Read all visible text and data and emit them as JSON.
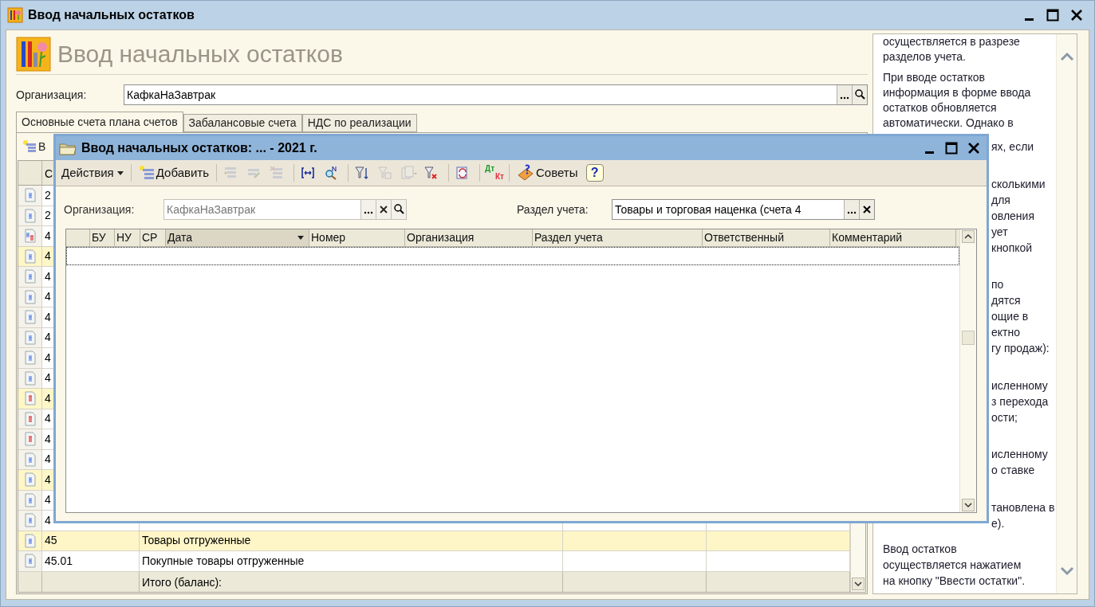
{
  "window": {
    "title": "Ввод начальных остатков"
  },
  "header": {
    "title": "Ввод начальных остатков"
  },
  "organization": {
    "label": "Организация:",
    "value": "КафкаНаЗавтрак"
  },
  "tabs": [
    {
      "label": "Основные счета плана счетов",
      "selected": true
    },
    {
      "label": "Забалансовые счета",
      "selected": false
    },
    {
      "label": "НДС по реализации",
      "selected": false
    }
  ],
  "tab_toolbar": {
    "button_label": "В"
  },
  "accounts_table": {
    "column_1": "С",
    "rows": [
      {
        "code": "2",
        "kind": "active",
        "highlighted": false
      },
      {
        "code": "2",
        "kind": "active",
        "highlighted": false
      },
      {
        "code": "4",
        "kind": "active-passive",
        "highlighted": false
      },
      {
        "code": "4",
        "kind": "active",
        "highlighted": true
      },
      {
        "code": "4",
        "kind": "active",
        "highlighted": false
      },
      {
        "code": "4",
        "kind": "active",
        "highlighted": false
      },
      {
        "code": "4",
        "kind": "active",
        "highlighted": false
      },
      {
        "code": "4",
        "kind": "active",
        "highlighted": false
      },
      {
        "code": "4",
        "kind": "active",
        "highlighted": false
      },
      {
        "code": "4",
        "kind": "active",
        "highlighted": false
      },
      {
        "code": "4",
        "kind": "passive",
        "highlighted": true
      },
      {
        "code": "4",
        "kind": "passive",
        "highlighted": false
      },
      {
        "code": "4",
        "kind": "passive",
        "highlighted": false
      },
      {
        "code": "4",
        "kind": "active",
        "highlighted": false
      },
      {
        "code": "4",
        "kind": "active",
        "highlighted": true
      },
      {
        "code": "4",
        "kind": "active",
        "highlighted": false
      },
      {
        "code": "4",
        "kind": "active",
        "highlighted": false
      },
      {
        "code": "45",
        "name": "Товары отгруженные",
        "kind": "active",
        "highlighted": true
      },
      {
        "code": "45.01",
        "name": "Покупные товары отгруженные",
        "kind": "active",
        "highlighted": false
      }
    ],
    "footer": {
      "name": "Итого (баланс):"
    }
  },
  "help": {
    "paragraphs": [
      {
        "kind": "full",
        "lines": [
          "осуществляется в разрезе",
          "разделов учета."
        ]
      },
      {
        "kind": "full",
        "lines": [
          "При вводе остатков",
          "информация в форме ввода",
          "остатков обновляется",
          "автоматически. Однако в"
        ]
      },
      {
        "kind": "partial",
        "lines": [
          "ях, если"
        ]
      },
      {
        "kind": "partial",
        "lines": [
          "сколькими",
          "для",
          "овления",
          "ует",
          "кнопкой"
        ]
      },
      {
        "kind": "partial",
        "lines": [
          "по",
          "дятся",
          "ощие в",
          "ектно",
          "гу продаж):"
        ]
      },
      {
        "kind": "partial",
        "lines": [
          "исленному",
          "з перехода",
          "ости;"
        ]
      },
      {
        "kind": "partial",
        "lines": [
          "исленному",
          "о ставке"
        ]
      },
      {
        "kind": "partial",
        "lines": [
          "тановлена в",
          "е)."
        ]
      },
      {
        "kind": "full",
        "lines": [
          "Ввод остатков",
          "осуществляется нажатием",
          "на кнопку \"Ввести остатки\"."
        ]
      }
    ]
  },
  "dialog": {
    "title": "Ввод начальных остатков: ... - 2021 г.",
    "toolbar": [
      {
        "kind": "menu",
        "label": "Действия"
      },
      {
        "kind": "separator"
      },
      {
        "kind": "button",
        "label": "Добавить"
      },
      {
        "kind": "separator"
      },
      {
        "kind": "icon",
        "disabled": true
      },
      {
        "kind": "icon",
        "disabled": true
      },
      {
        "kind": "icon",
        "disabled": true
      },
      {
        "kind": "separator"
      },
      {
        "kind": "icon",
        "disabled": false
      },
      {
        "kind": "icon",
        "disabled": false
      },
      {
        "kind": "separator"
      },
      {
        "kind": "icon",
        "disabled": false
      },
      {
        "kind": "icon",
        "disabled": true
      },
      {
        "kind": "icon",
        "disabled": true
      },
      {
        "kind": "icon",
        "disabled": false
      },
      {
        "kind": "separator"
      },
      {
        "kind": "icon",
        "disabled": false
      },
      {
        "kind": "separator"
      },
      {
        "kind": "dtkt",
        "top": "Дт",
        "bottom": "Кт"
      },
      {
        "kind": "separator"
      },
      {
        "kind": "button",
        "label": "Советы"
      },
      {
        "kind": "help",
        "label": "?"
      }
    ],
    "organization": {
      "label": "Организация:",
      "value": "КафкаНаЗавтрак",
      "disabled": true
    },
    "section": {
      "label": "Раздел учета:",
      "value": "Товары и торговая наценка (счета 4"
    },
    "table": {
      "columns": [
        {
          "label": "БУ",
          "sorted": false
        },
        {
          "label": "НУ",
          "sorted": false
        },
        {
          "label": "СР",
          "sorted": false
        },
        {
          "label": "Дата",
          "sorted": true
        },
        {
          "label": "Номер",
          "sorted": false
        },
        {
          "label": "Организация",
          "sorted": false
        },
        {
          "label": "Раздел учета",
          "sorted": false
        },
        {
          "label": "Ответственный",
          "sorted": false
        },
        {
          "label": "Комментарий",
          "sorted": false
        }
      ],
      "rows": [
        {
          "selected": true
        }
      ]
    }
  }
}
